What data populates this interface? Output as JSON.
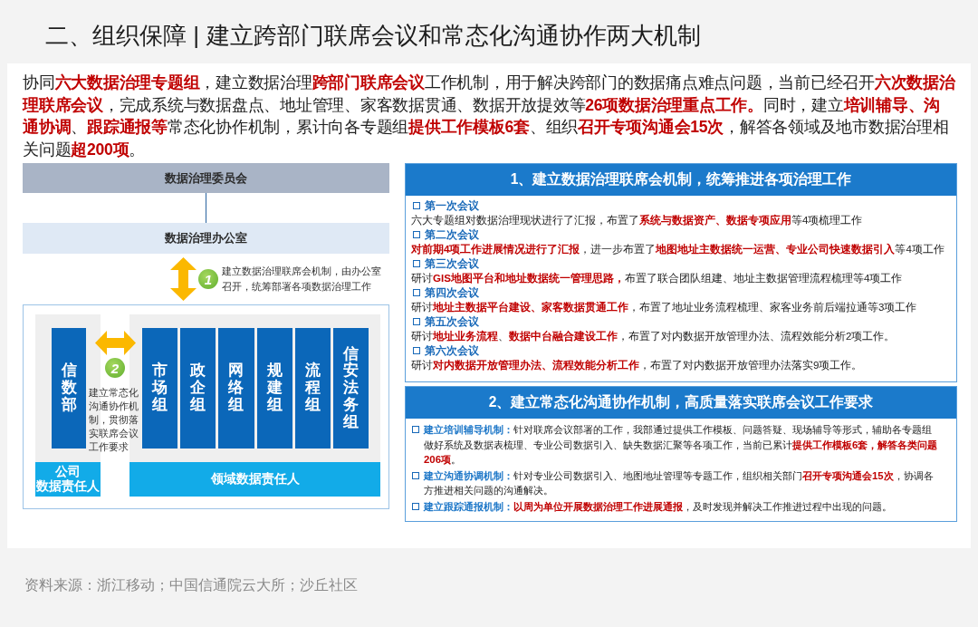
{
  "title": "二、组织保障 | 建立跨部门联席会议和常态化沟通协作两大机制",
  "intro": "协同**六大数据治理专题组**，建立数据治理**跨部门联席会议**工作机制，用于解决跨部门的数据痛点难点问题，当前已经召开**六次数据治理联席会议**，完成系统与数据盘点、地址管理、家客数据贯通、数据开放提效等**26项数据治理重点工作。**同时，建立**培训辅导、沟通协调**、**跟踪通报等**常态化协作机制，累计向各专题组**提供工作模板6套**、组织**召开专项沟通会15次**，解答各领域及地市数据治理相关问题**超200项**。",
  "org_chart": {
    "committee": "数据治理委员会",
    "office": "数据治理办公室",
    "step_1": {
      "number": "1",
      "text": "建立数据治理联席会机制，由办公室召开，统筹部署各项数据治理工作"
    },
    "department": "信数部",
    "step_2": {
      "number": "2",
      "text": "建立常态化沟通协作机制，贯彻落实联席会议工作要求"
    },
    "groups": [
      "市场组",
      "政企组",
      "网络组",
      "规建组",
      "流程组",
      "信安法务组"
    ],
    "company_owner": [
      "公司",
      "数据责任人"
    ],
    "domain_owner": [
      "领域数据责任人"
    ]
  },
  "meetings": {
    "title": "1、建立数据治理联席会机制，统筹推进各项治理工作",
    "items": [
      {
        "heading": "第一次会议",
        "text": "六大专题组对数据治理现状进行了汇报，布置了**系统与数据资产、数据专项应用**等4项梳理工作"
      },
      {
        "heading": "第二次会议",
        "text": "**对前期4项工作进展情况进行了汇报**，进一步布置了**地图地址主数据统一运营、专业公司快速数据引入**等4项工作"
      },
      {
        "heading": "第三次会议",
        "text": "研讨**GIS地图平台和地址数据统一管理思路，**布置了联合团队组建、地址主数据管理流程梳理等4项工作"
      },
      {
        "heading": "第四次会议",
        "text": "研讨**地址主数据平台建设、家客数据贯通工作**，布置了地址业务流程梳理、家客业务前后端拉通等3项工作"
      },
      {
        "heading": "第五次会议",
        "text": "研讨**地址业务流程**、**数据中台融合建设工作**，布置了对内数据开放管理办法、流程效能分析2项工作。"
      },
      {
        "heading": "第六次会议",
        "text": "研讨**对内数据开放管理办法、流程效能分析工作**，布置了对内数据开放管理办法落实9项工作。"
      }
    ]
  },
  "mechanisms": {
    "title": "2、建立常态化沟通协作机制，高质量落实联席会议工作要求",
    "items": [
      {
        "label": "建立培训辅导机制：",
        "text": "针对联席会议部署的工作，我部通过提供工作模板、问题答疑、现场辅导等形式，辅助各专题组做好系统及数据表梳理、专业公司数据引入、缺失数据汇聚等各项工作，当前已累计**提供工作模板6套，解答各类问题206项**。"
      },
      {
        "label": "建立沟通协调机制：",
        "text": "针对专业公司数据引入、地图地址管理等专题工作，组织相关部门**召开专项沟通会15次**，协调各方推进相关问题的沟通解决。"
      },
      {
        "label": "建立跟踪通报机制：",
        "text": "**以周为单位开展数据治理工作进展通报**，及时发现并解决工作推进过程中出现的问题。"
      }
    ]
  },
  "source": "资料来源：浙江移动；中国信通院云大所；沙丘社区"
}
